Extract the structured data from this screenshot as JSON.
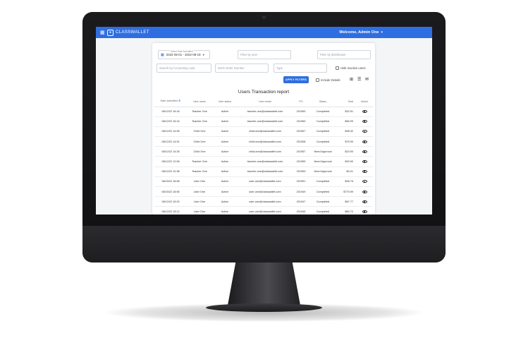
{
  "app": {
    "brand": "CLASSWALLET",
    "welcome": "Welcome, Admin One"
  },
  "filters": {
    "date_label": "Select Date Submitted",
    "date_range": "2022-05-01 - 2022-08-18",
    "user_placeholder": "Filter by user",
    "distribution_placeholder": "Filter by distribution",
    "accounting_placeholder": "Search by Accounting code",
    "work_order_placeholder": "Work Order Number",
    "type_placeholder": "Type",
    "hide_inactive_label": "Hide Inactive users",
    "include_details_label": "Include Details",
    "apply_label": "APPLY FILTERS"
  },
  "report": {
    "title": "Users Transaction report",
    "columns": [
      "Date submitted",
      "User name",
      "User status",
      "User email",
      "PO",
      "Status",
      "Total",
      "Action"
    ],
    "rows": [
      [
        "08/12/22 16:18",
        "Teacher One",
        "Active",
        "teacher-one@classwallet.com",
        "201963",
        "Completed",
        "$32.51"
      ],
      [
        "08/12/22 16:16",
        "Teacher One",
        "Active",
        "teacher-one@classwallet.com",
        "201963",
        "Completed",
        "$65.99"
      ],
      [
        "08/12/22 14:55",
        "Child One",
        "Active",
        "child-one@classwallet.com",
        "201967",
        "Completed",
        "$98.32"
      ],
      [
        "08/12/22 14:51",
        "Child One",
        "Active",
        "child-one@classwallet.com",
        "201908",
        "Completed",
        "$75.90"
      ],
      [
        "08/12/22 14:26",
        "Child One",
        "Active",
        "child-one@classwallet.com",
        "201957",
        "Need Approval",
        "$23.90"
      ],
      [
        "08/12/22 12:06",
        "Teacher One",
        "Active",
        "teacher-one@classwallet.com",
        "201955",
        "Need Approval",
        "$93.90"
      ],
      [
        "08/12/22 10:38",
        "Teacher One",
        "Active",
        "teacher-one@classwallet.com",
        "201953",
        "Need Approval",
        "$0.01"
      ],
      [
        "08/15/22 18:56",
        "User One",
        "Active",
        "user-one@classwallet.com",
        "201951",
        "Completed",
        "$46.76"
      ],
      [
        "08/15/22 18:55",
        "User One",
        "Active",
        "user-one@classwallet.com",
        "201949",
        "Completed",
        "$779.99"
      ],
      [
        "08/12/22 15:20",
        "User One",
        "Active",
        "user-one@classwallet.com",
        "201947",
        "Completed",
        "$67.77"
      ],
      [
        "08/12/22 15:12",
        "User One",
        "Active",
        "user-one@classwallet.com",
        "201945",
        "Completed",
        "$60.72"
      ]
    ]
  },
  "icons": {
    "menu": "menu-icon",
    "logo": "classwallet-logo-icon",
    "calendar": "calendar-icon",
    "sort": "arrow-down-icon",
    "view": "eye-icon",
    "export": "export-icon",
    "list": "list-icon",
    "email": "email-icon"
  },
  "colors": {
    "accent": "#2f6ee0"
  }
}
